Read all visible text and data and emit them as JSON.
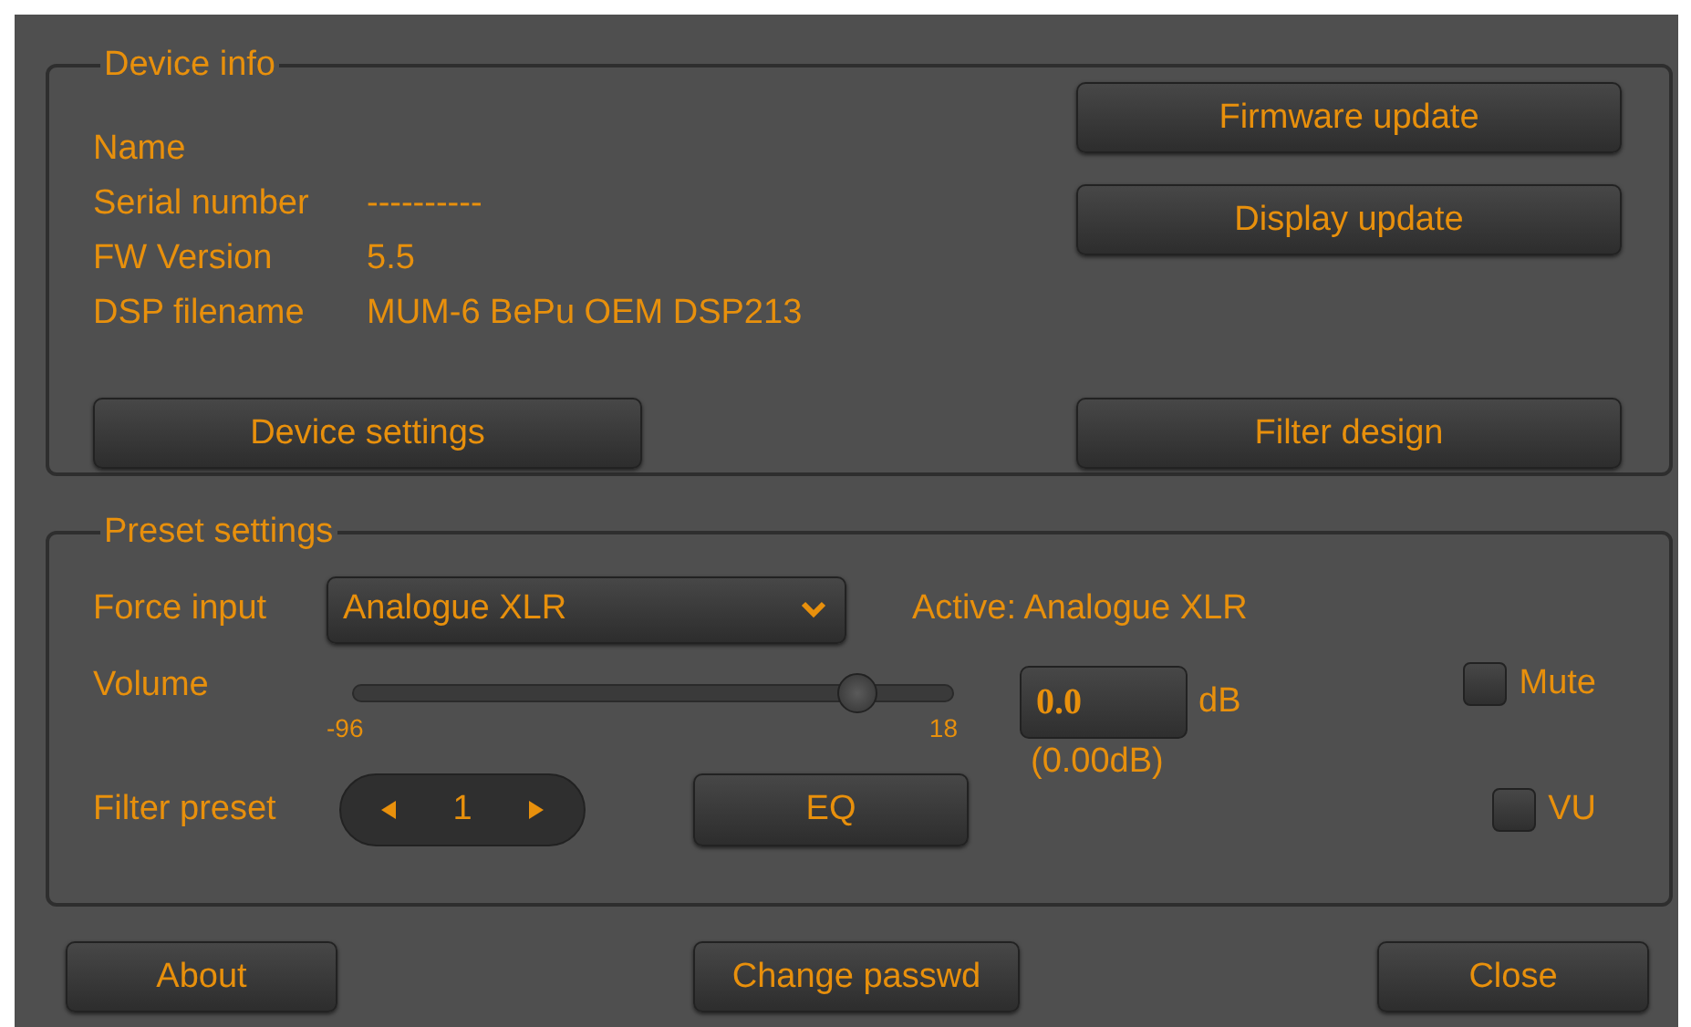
{
  "device_info": {
    "title": "Device info",
    "fields": [
      {
        "label": "Name"
      },
      {
        "label": "Serial number",
        "value": "----------"
      },
      {
        "label": "FW Version",
        "value": "5.5"
      },
      {
        "label": "DSP filename",
        "value": "MUM-6 BePu OEM DSP213"
      }
    ],
    "side_buttons": [
      "Firmware update",
      "Display update"
    ],
    "buttons": [
      "Device settings",
      "Filter design"
    ]
  },
  "preset_settings": {
    "title": "Preset settings",
    "force_input": {
      "label": "Force input",
      "value": "Analogue XLR"
    },
    "active": "Active: Analogue XLR",
    "volume": {
      "label": "Volume",
      "level": 0.84,
      "min": "-96",
      "max": "18",
      "value": "0.0",
      "unit": "dB",
      "reading": "(0.00dB)"
    },
    "filter_preset": {
      "label": "Filter preset",
      "value": "1"
    },
    "eq_button": "EQ",
    "checkboxes": [
      {
        "label": "Mute",
        "checked": false
      },
      {
        "label": "VU",
        "checked": false
      }
    ]
  },
  "footer_buttons": [
    "About",
    "Change passwd",
    "Close"
  ]
}
